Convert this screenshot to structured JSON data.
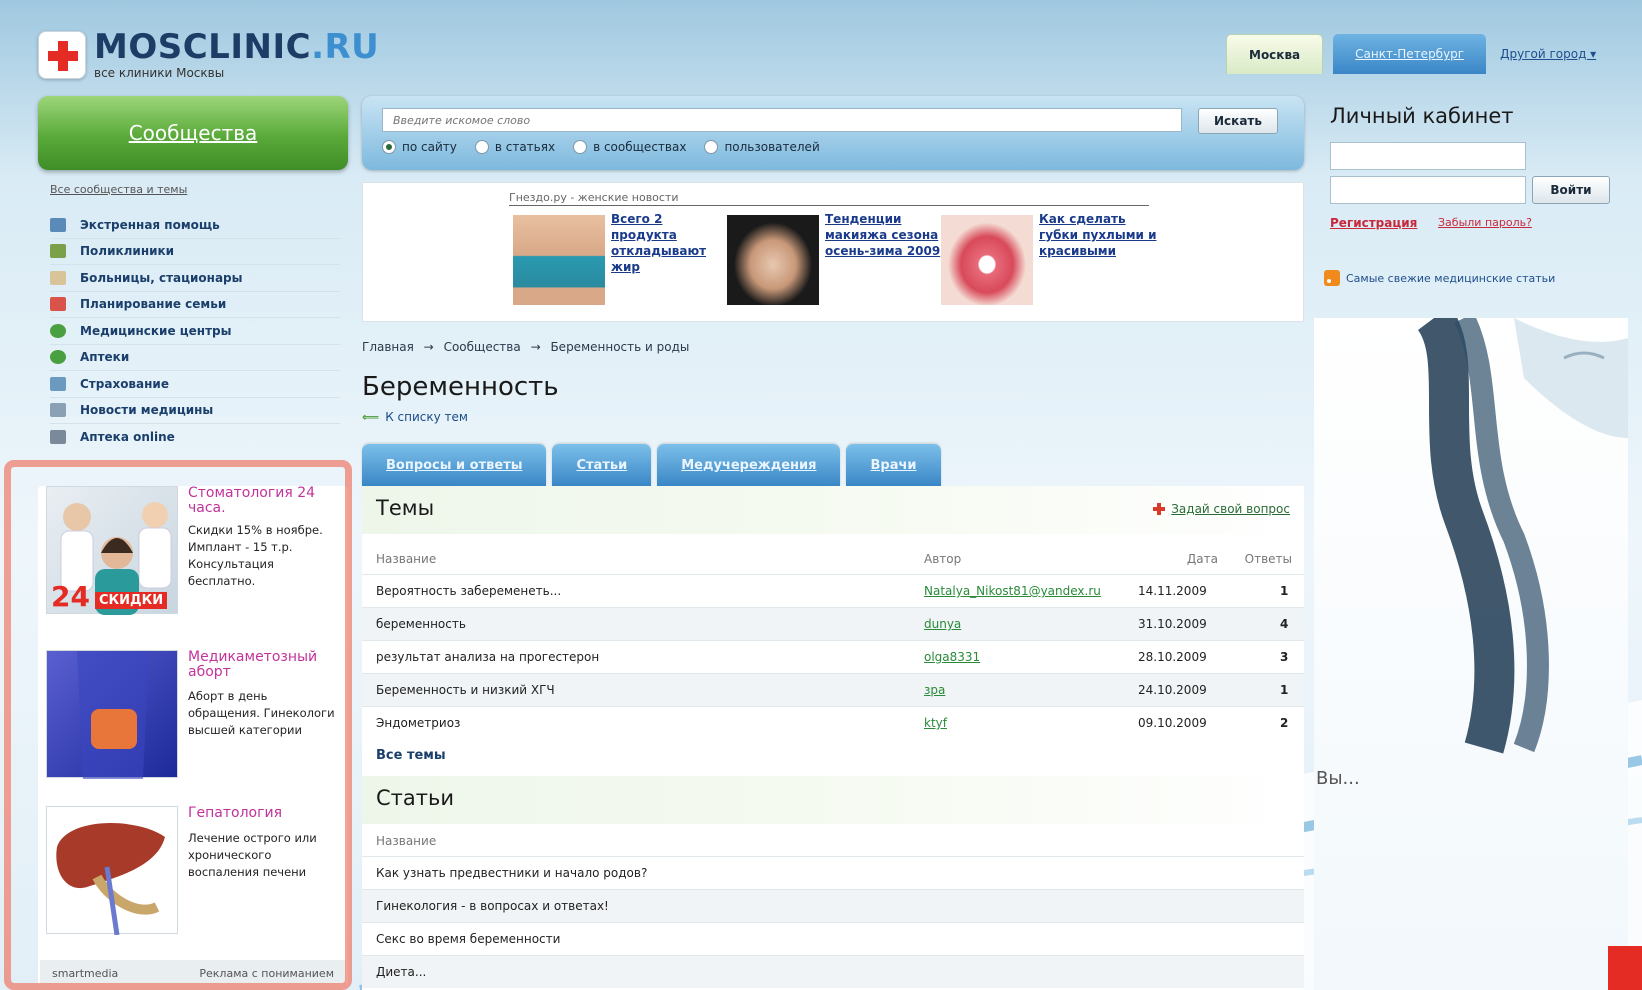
{
  "header": {
    "logo_title": "MOSCLINIC",
    "logo_ru": ".RU",
    "logo_sub": "все клиники Москвы",
    "cities": [
      {
        "label": "Москва",
        "active": true
      },
      {
        "label": "Санкт-Петербург",
        "active": false
      }
    ],
    "other_city": "Другой город ▾"
  },
  "sidebar": {
    "communities_button": "Сообщества",
    "all_link": "Все сообщества и темы",
    "items": [
      {
        "label": "Экстренная помощь",
        "icon": "emergency-icon",
        "color": "#5a8ab8"
      },
      {
        "label": "Поликлиники",
        "icon": "clinic-icon",
        "color": "#7aa04a"
      },
      {
        "label": "Больницы, стационары",
        "icon": "hospital-icon",
        "color": "#d9c49a"
      },
      {
        "label": "Планирование семьи",
        "icon": "calendar-icon",
        "color": "#d9534a"
      },
      {
        "label": "Медицинские центры",
        "icon": "medical-cross-icon",
        "color": "#4aa040"
      },
      {
        "label": "Аптеки",
        "icon": "pharmacy-icon",
        "color": "#4aa040"
      },
      {
        "label": "Страхование",
        "icon": "insurance-icon",
        "color": "#6a9ac0"
      },
      {
        "label": "Новости медицины",
        "icon": "news-icon",
        "color": "#8aa0b5"
      },
      {
        "label": "Аптека online",
        "icon": "online-pharmacy-icon",
        "color": "#7a8a9a"
      }
    ]
  },
  "ads": {
    "items": [
      {
        "title": "Стоматология 24 часа.",
        "text": "Скидки 15% в ноябре. Имплант - 15 т.р. Консультация бесплатно.",
        "badge_num": "24",
        "badge_text": "СКИДКИ"
      },
      {
        "title": "Медикаметозный аборт",
        "text": "Аборт в день обращения. Гинекологи высшей категории"
      },
      {
        "title": "Гепатология",
        "text": "Лечение острого или хронического воспаления печени"
      }
    ],
    "footer_brand": "smartmedia",
    "footer_text": "Реклама с пониманием"
  },
  "search": {
    "placeholder": "Введите искомое слово",
    "button": "Искать",
    "options": [
      {
        "label": "по сайту",
        "checked": true
      },
      {
        "label": "в статьях",
        "checked": false
      },
      {
        "label": "в сообществах",
        "checked": false
      },
      {
        "label": "пользователей",
        "checked": false
      }
    ]
  },
  "news": {
    "source": "Гнездо.ру - женские новости",
    "items": [
      {
        "title": "Всего 2 продукта откладывают жир"
      },
      {
        "title": "Тенденции макияжа сезона осень-зима 2009"
      },
      {
        "title": "Как сделать губки пухлыми и красивыми"
      }
    ]
  },
  "breadcrumb": {
    "items": [
      "Главная",
      "Сообщества",
      "Беременность и роды"
    ],
    "sep": "→"
  },
  "page": {
    "title": "Беременность",
    "back": "К списку тем"
  },
  "tabs": [
    "Вопросы и ответы",
    "Статьи",
    "Медучереждения",
    "Врачи"
  ],
  "themes": {
    "title": "Темы",
    "ask": "Задай свой вопрос",
    "headers": {
      "name": "Название",
      "author": "Автор",
      "date": "Дата",
      "answers": "Ответы"
    },
    "rows": [
      {
        "name": "Вероятность забеременеть...",
        "author": "Natalya_Nikost81@yandex.ru",
        "date": "14.11.2009",
        "answers": "1"
      },
      {
        "name": "беременность",
        "author": "dunya",
        "date": "31.10.2009",
        "answers": "4"
      },
      {
        "name": "результат анализа на прогестерон",
        "author": "olga8331",
        "date": "28.10.2009",
        "answers": "3"
      },
      {
        "name": "Беременность и низкий ХГЧ",
        "author": "зра",
        "date": "24.10.2009",
        "answers": "1"
      },
      {
        "name": "Эндометриоз",
        "author": "ktyf",
        "date": "09.10.2009",
        "answers": "2"
      }
    ],
    "all": "Все темы"
  },
  "articles": {
    "title": "Статьи",
    "header": "Название",
    "rows": [
      "Как узнать предвестники и начало родов?",
      "Гинекология - в вопросах и ответах!",
      "Секс во время беременности"
    ],
    "partial": "Диета..."
  },
  "account": {
    "title": "Личный кабинет",
    "login": "Войти",
    "register": "Регистрация",
    "forgot": "Забыли пароль?",
    "rss": "Самые свежие медицинские статьи",
    "banner_text": "Вы..."
  }
}
